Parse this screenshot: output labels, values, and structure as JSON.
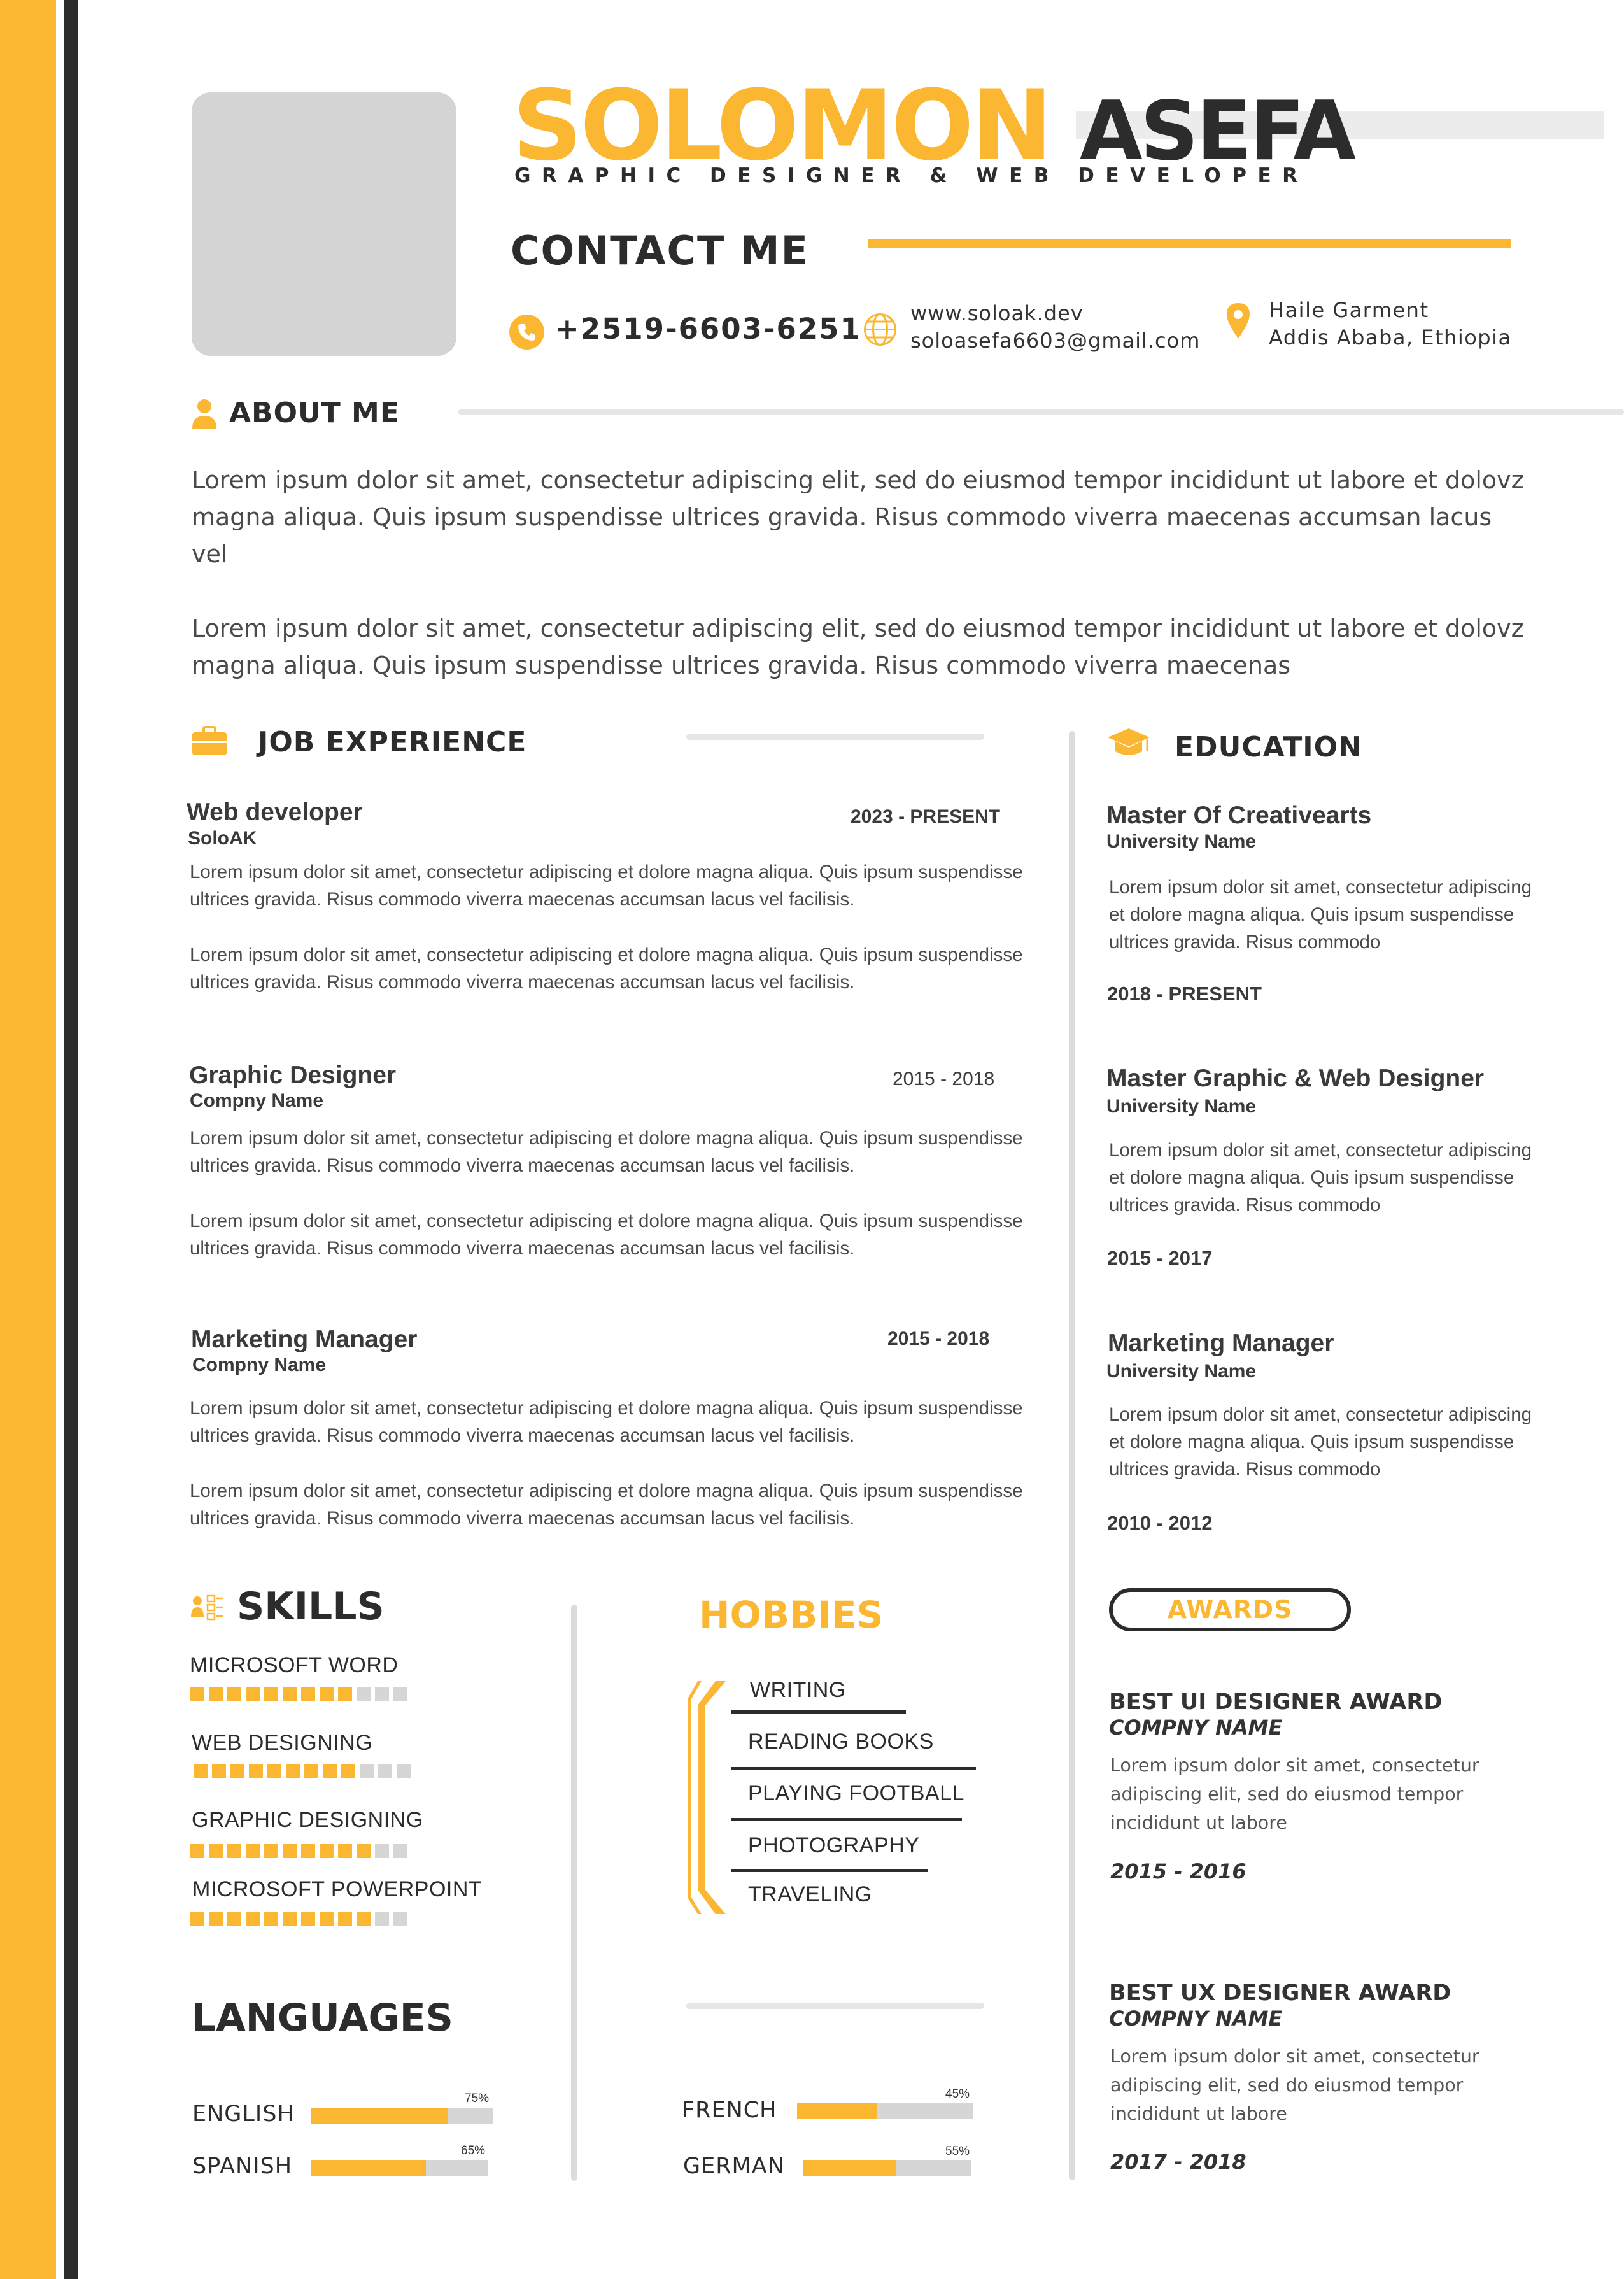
{
  "header": {
    "first_name": "SOLOMON",
    "last_name": "ASEFA",
    "tagline": "GRAPHIC DESIGNER & WEB DEVELOPER"
  },
  "contact": {
    "heading": "CONTACT ME",
    "phone": "+2519-6603-6251",
    "website": "www.soloak.dev",
    "email": "soloasefa6603@gmail.com",
    "address_line1": "Haile Garment",
    "address_line2": "Addis Ababa, Ethiopia"
  },
  "about": {
    "heading": "ABOUT ME",
    "paragraph1": "Lorem ipsum dolor sit amet, consectetur adipiscing elit, sed do eiusmod tempor incididunt ut labore et dolovz magna aliqua. Quis ipsum suspendisse ultrices gravida. Risus commodo viverra maecenas accumsan lacus vel",
    "paragraph2": "Lorem ipsum dolor sit amet, consectetur adipiscing elit, sed do eiusmod tempor incididunt ut labore et dolovz magna aliqua. Quis ipsum suspendisse ultrices gravida. Risus commodo viverra maecenas"
  },
  "experience": {
    "heading": "JOB EXPERIENCE",
    "jobs": [
      {
        "title": "Web developer",
        "company": "SoloAK",
        "date": "2023 - PRESENT",
        "p1": "Lorem ipsum dolor sit amet, consectetur adipiscing  et dolore magna aliqua. Quis ipsum suspendisse ultrices gravida. Risus commodo viverra maecenas accumsan lacus vel facilisis.",
        "p2": "Lorem ipsum dolor sit amet, consectetur adipiscing  et dolore magna aliqua. Quis ipsum suspendisse ultrices gravida. Risus commodo viverra maecenas accumsan lacus vel facilisis."
      },
      {
        "title": "Graphic Designer",
        "company": "Compny Name",
        "date": "2015 - 2018",
        "p1": "Lorem ipsum dolor sit amet, consectetur adipiscing  et dolore magna aliqua. Quis ipsum suspendisse ultrices gravida. Risus commodo viverra maecenas accumsan lacus vel facilisis.",
        "p2": "Lorem ipsum dolor sit amet, consectetur adipiscing  et dolore magna aliqua. Quis ipsum suspendisse ultrices gravida. Risus commodo viverra maecenas accumsan lacus vel facilisis."
      },
      {
        "title": "Marketing Manager",
        "company": "Compny Name",
        "date": "2015 - 2018",
        "p1": "Lorem ipsum dolor sit amet, consectetur adipiscing  et dolore magna aliqua. Quis ipsum suspendisse ultrices gravida. Risus commodo viverra maecenas accumsan lacus vel facilisis.",
        "p2": "Lorem ipsum dolor sit amet, consectetur adipiscing  et dolore magna aliqua. Quis ipsum suspendisse ultrices gravida. Risus commodo viverra maecenas accumsan lacus vel facilisis."
      }
    ]
  },
  "education": {
    "heading": "EDUCATION",
    "items": [
      {
        "degree": "Master Of Creativearts",
        "school": "University Name",
        "text": "Lorem ipsum dolor sit amet, consectetur adipiscing  et dolore magna aliqua. Quis ipsum suspendisse ultrices gravida. Risus commodo",
        "date": "2018 - PRESENT"
      },
      {
        "degree": "Master Graphic & Web Designer",
        "school": "University Name",
        "text": "Lorem ipsum dolor sit amet, consectetur adipiscing  et dolore magna aliqua. Quis ipsum suspendisse ultrices gravida. Risus commodo",
        "date": "2015 - 2017"
      },
      {
        "degree": "Marketing Manager",
        "school": "University Name",
        "text": "Lorem ipsum dolor sit amet, consectetur adipiscing  et dolore magna aliqua. Quis ipsum suspendisse ultrices gravida. Risus commodo",
        "date": "2010 - 2012"
      }
    ]
  },
  "skills": {
    "heading": "SKILLS",
    "items": [
      {
        "name": "MICROSOFT WORD",
        "filled": 9,
        "total": 12
      },
      {
        "name": "WEB DESIGNING",
        "filled": 9,
        "total": 12
      },
      {
        "name": "GRAPHIC DESIGNING",
        "filled": 10,
        "total": 12
      },
      {
        "name": "MICROSOFT POWERPOINT",
        "filled": 10,
        "total": 12
      }
    ]
  },
  "hobbies": {
    "heading": "HOBBIES",
    "items": [
      "WRITING",
      "READING BOOKS",
      "PLAYING FOOTBALL",
      "PHOTOGRAPHY",
      "TRAVELING"
    ]
  },
  "languages": {
    "heading": "LANGUAGES",
    "items": [
      {
        "name": "ENGLISH",
        "percent_label": "75%",
        "level": 0.75
      },
      {
        "name": "SPANISH",
        "percent_label": "65%",
        "level": 0.65
      },
      {
        "name": "FRENCH",
        "percent_label": "45%",
        "level": 0.45
      },
      {
        "name": "GERMAN",
        "percent_label": "55%",
        "level": 0.55
      }
    ]
  },
  "awards": {
    "heading": "AWARDS",
    "items": [
      {
        "title": "BEST UI DESIGNER AWARD",
        "company": "COMPNY NAME",
        "text": "Lorem ipsum dolor sit amet, consectetur adipiscing elit, sed do eiusmod tempor incididunt ut labore",
        "date": "2015 - 2016"
      },
      {
        "title": "BEST UX DESIGNER AWARD",
        "company": "COMPNY NAME",
        "text": "Lorem ipsum dolor sit amet, consectetur adipiscing elit, sed do eiusmod tempor incididunt ut labore",
        "date": "2017 - 2018"
      }
    ]
  },
  "colors": {
    "accent": "#fbb632",
    "dark": "#2c2c2c",
    "photo_placeholder": "#d4d4d4"
  }
}
